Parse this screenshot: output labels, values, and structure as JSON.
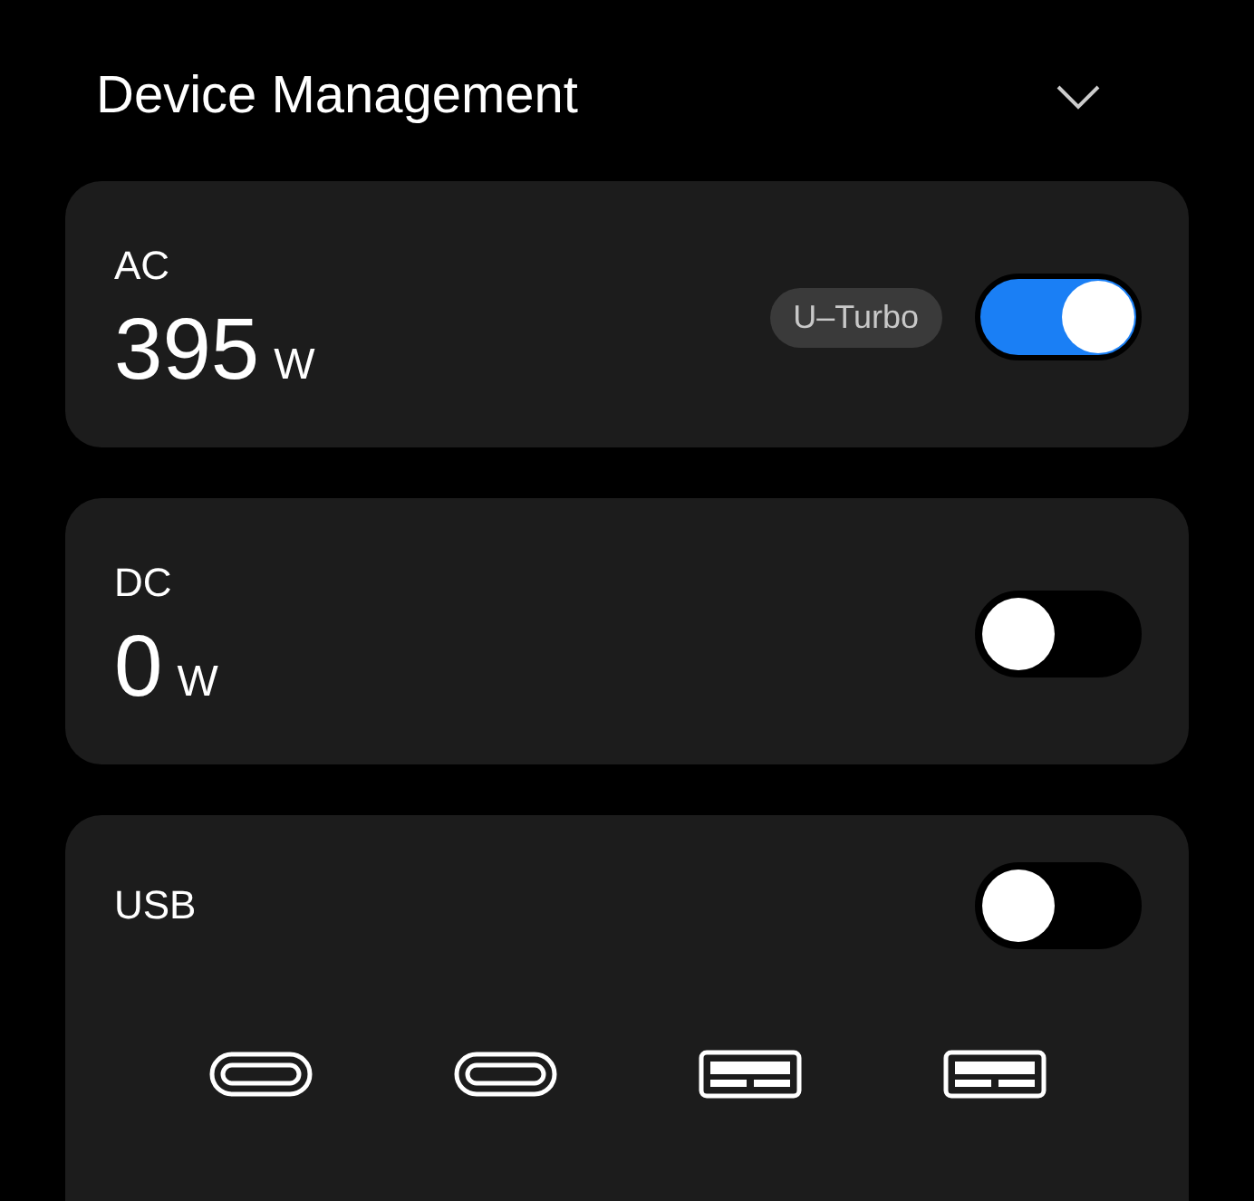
{
  "header": {
    "title": "Device Management",
    "expanded": false
  },
  "outputs": [
    {
      "label": "AC",
      "value": "395",
      "unit": "W",
      "badge": "U–Turbo",
      "on": true
    },
    {
      "label": "DC",
      "value": "0",
      "unit": "W",
      "on": false
    }
  ],
  "usb": {
    "label": "USB",
    "on": false,
    "ports": [
      {
        "kind": "usb-c"
      },
      {
        "kind": "usb-c"
      },
      {
        "kind": "usb-a"
      },
      {
        "kind": "usb-a"
      }
    ]
  }
}
